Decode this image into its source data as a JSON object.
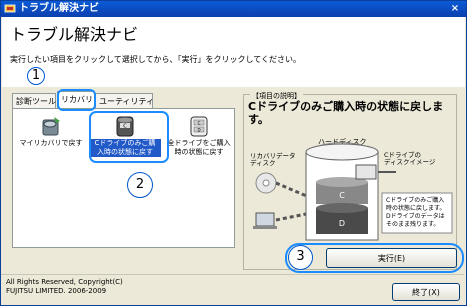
{
  "window": {
    "title": "トラブル解決ナビ",
    "close": "×"
  },
  "header": {
    "heading": "トラブル解決ナビ",
    "instruction": "実行したい項目をクリックして選択してから、「実行」をクリックしてください。"
  },
  "callouts": [
    "1",
    "2",
    "3"
  ],
  "tabs": [
    {
      "label": "診断ツール",
      "active": false
    },
    {
      "label": "リカバリ",
      "active": true
    },
    {
      "label": "ユーティリティ",
      "active": false
    }
  ],
  "items": [
    {
      "line1": "マイリカバリで戻す",
      "line2": "",
      "selected": false,
      "icon": "my-recovery-icon"
    },
    {
      "line1": "Cドライブのみご購",
      "line2": "入時の状態に戻す",
      "selected": true,
      "icon": "c-drive-restore-icon"
    },
    {
      "line1": "全ドライブをご購入",
      "line2": "時の状態に戻す",
      "selected": false,
      "icon": "all-drive-restore-icon"
    }
  ],
  "description": {
    "legend": "【項目の説明】",
    "text": "Cドライブのみご購入時の状態に戻します。",
    "diagram": {
      "recovery_data_disk": [
        "リカバリデータ",
        "ディスク"
      ],
      "hard_disk": "ハードディスク",
      "c_drive_image": [
        "Cドライブの",
        "ディスクイメージ"
      ],
      "c_label": "C",
      "d_label": "D",
      "note": [
        "Cドライブのみご購入",
        "時の状態に戻します。",
        "Dドライブのデータは",
        "そのまま残ります。"
      ]
    }
  },
  "buttons": {
    "execute": "実行(E)",
    "exit": "終了(X)"
  },
  "footer": {
    "copyright_line1": "All Rights Reserved, Copyright(C)",
    "copyright_line2": "FUJITSU LIMITED. 2006-2009"
  }
}
